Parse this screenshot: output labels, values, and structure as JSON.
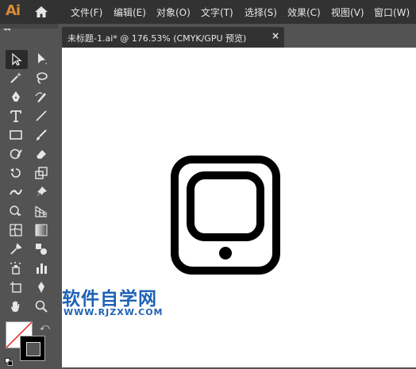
{
  "app": {
    "logo": "Ai"
  },
  "menu": [
    "文件(F)",
    "编辑(E)",
    "对象(O)",
    "文字(T)",
    "选择(S)",
    "效果(C)",
    "视图(V)",
    "窗口(W)"
  ],
  "document": {
    "tab_title": "未标题-1.ai* @ 176.53% (CMYK/GPU 预览)",
    "close_label": "×"
  },
  "toolbar": {
    "collapse_label": "◂◂",
    "swap_label": "⤺"
  },
  "watermark": {
    "chinese": "软件自学网",
    "url": "WWW.RJZXW.COM"
  },
  "colors": {
    "fill": "#ffffff",
    "stroke": "#000000",
    "menubar": "#323232",
    "panel": "#535353",
    "watermark": "#1e62b6"
  },
  "tools": [
    {
      "name": "selection-tool",
      "icon": "arrow"
    },
    {
      "name": "direct-selection-tool",
      "icon": "white-arrow"
    },
    {
      "name": "magic-wand-tool",
      "icon": "wand"
    },
    {
      "name": "lasso-tool",
      "icon": "lasso"
    },
    {
      "name": "pen-tool",
      "icon": "pen"
    },
    {
      "name": "curvature-tool",
      "icon": "curvature-pen"
    },
    {
      "name": "type-tool",
      "icon": "T"
    },
    {
      "name": "line-segment-tool",
      "icon": "line"
    },
    {
      "name": "rectangle-tool",
      "icon": "rect"
    },
    {
      "name": "paintbrush-tool",
      "icon": "brush"
    },
    {
      "name": "shaper-tool",
      "icon": "shaper"
    },
    {
      "name": "eraser-tool",
      "icon": "eraser"
    },
    {
      "name": "rotate-tool",
      "icon": "rotate"
    },
    {
      "name": "scale-tool",
      "icon": "scale"
    },
    {
      "name": "width-tool",
      "icon": "width"
    },
    {
      "name": "puppet-warp-tool",
      "icon": "pin"
    },
    {
      "name": "shape-builder-tool",
      "icon": "shape-builder"
    },
    {
      "name": "perspective-grid-tool",
      "icon": "perspective"
    },
    {
      "name": "mesh-tool",
      "icon": "mesh"
    },
    {
      "name": "gradient-tool",
      "icon": "gradient"
    },
    {
      "name": "eyedropper-tool",
      "icon": "eyedropper"
    },
    {
      "name": "blend-tool",
      "icon": "blend"
    },
    {
      "name": "symbol-sprayer-tool",
      "icon": "symbol"
    },
    {
      "name": "column-graph-tool",
      "icon": "graph"
    },
    {
      "name": "artboard-tool",
      "icon": "artboard"
    },
    {
      "name": "slice-tool",
      "icon": "slice"
    },
    {
      "name": "hand-tool",
      "icon": "hand"
    },
    {
      "name": "zoom-tool",
      "icon": "zoom"
    }
  ]
}
